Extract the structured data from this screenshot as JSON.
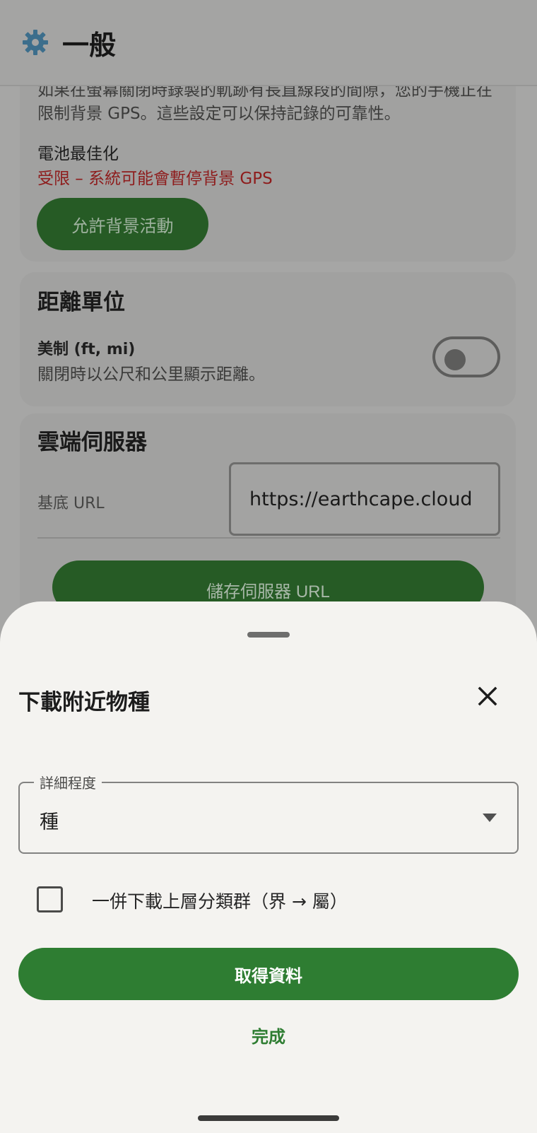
{
  "app_bar": {
    "title": "一般",
    "icon": "gear-icon"
  },
  "battery": {
    "paragraph": "如果在螢幕關閉時錄製的軌跡有長直線段的間隙，您的手機正在限制背景 GPS。這些設定可以保持記錄的可靠性。",
    "label": "電池最佳化",
    "status": "受限 – 系統可能會暫停背景 GPS",
    "allow_button": "允許背景活動"
  },
  "units": {
    "title": "距離單位",
    "label": "美制 (ft, mi)",
    "description": "關閉時以公尺和公里顯示距離。",
    "toggle_on": false
  },
  "server": {
    "title": "雲端伺服器",
    "base_url_label": "基底 URL",
    "base_url_value": "https://earthcape.cloud",
    "save_button": "儲存伺服器 URL"
  },
  "sheet": {
    "title": "下載附近物種",
    "close_icon": "close-icon",
    "detail_level_label": "詳細程度",
    "detail_level_value": "種",
    "include_higher_label": "一併下載上層分類群（界 → 屬）",
    "include_higher_checked": false,
    "get_data_button": "取得資料",
    "done_button": "完成"
  },
  "colors": {
    "accent_green": "#2e7d32",
    "warning_red": "#8e1c1c",
    "sheet_background": "#f4f3f0"
  }
}
